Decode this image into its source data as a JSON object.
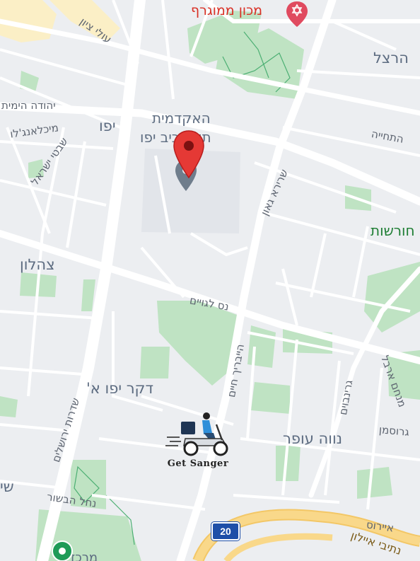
{
  "labels": {
    "makhon_mamograf": "מכון ממוגרף",
    "herzl": "הרצל",
    "yehuda_hayamit": "יהודה הימית",
    "yafo": "יפו",
    "michelangelo": "מיכלאנג'לו",
    "shivtei_israel": "שבטי ישראל",
    "olei_zion": "עולי ציון",
    "hatchiya": "התחייה",
    "sherira_gaon": "שרירא גאון",
    "horeshot": "חורשות",
    "academy_line1": "האקדמית",
    "academy_line2": "תל אביב יפו",
    "tzahalon": "צהלון",
    "nes_lagoyim": "נס לגויים",
    "heyvrik_haim": "הייבריך חיים",
    "dakar_yafo": "דקר יפו א'",
    "sderot_yerushalaim": "שדרות ירושלים",
    "menahem_arbel": "מנחם ארבל",
    "grinboim": "גרינבוים",
    "grossman": "גרוסמן",
    "neve_ofer": "נווה עופר",
    "nahal_habesor": "נחל הבשור",
    "eiros": "איירוס",
    "nativei_ayalon": "נתיבי איילון",
    "merkaz": "מרכז",
    "partial_left": "שי"
  },
  "route_shield": "20",
  "brand": {
    "name": "Get Sanger"
  },
  "colors": {
    "road": "#ffffff",
    "land": "#eceef1",
    "park": "#bfe3c3",
    "highway": "#f9d88a",
    "pin": "#e53935",
    "shield": "#1e4fa8"
  },
  "icons": [
    "location-pin-icon",
    "place-marker-icon",
    "synagogue-star-icon",
    "delivery-scooter-icon",
    "map-pin-green-icon"
  ]
}
